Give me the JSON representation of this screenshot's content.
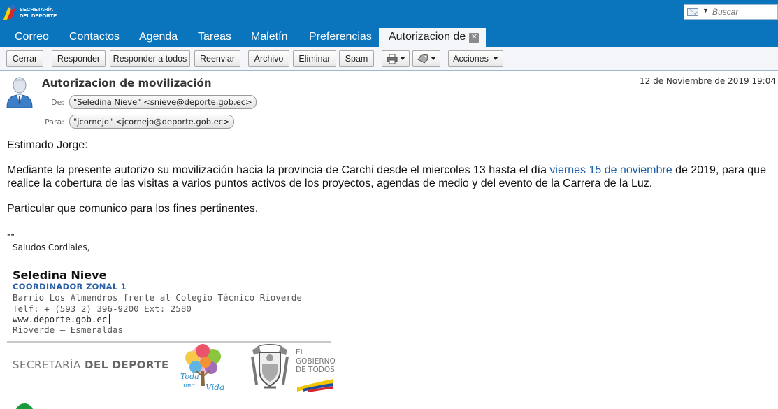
{
  "app": {
    "logo_text_line1": "SECRETARÍA",
    "logo_text_line2": "DEL DEPORTE"
  },
  "search": {
    "placeholder": "Buscar"
  },
  "tabs": [
    {
      "label": "Correo"
    },
    {
      "label": "Contactos"
    },
    {
      "label": "Agenda"
    },
    {
      "label": "Tareas"
    },
    {
      "label": "Maletín"
    },
    {
      "label": "Preferencias"
    },
    {
      "label": "Autorizacion de",
      "active": true
    }
  ],
  "toolbar": {
    "close_label": "Cerrar",
    "reply_label": "Responder",
    "reply_all_label": "Responder a todos",
    "forward_label": "Reenviar",
    "archive_label": "Archivo",
    "delete_label": "Eliminar",
    "spam_label": "Spam",
    "actions_label": "Acciones"
  },
  "message": {
    "subject": "Autorizacion de movilización",
    "date": "12 de Noviembre de 2019 19:04",
    "from_label": "De:",
    "from": "\"Seledina Nieve\" <snieve@deporte.gob.ec>",
    "to_label": "Para:",
    "to": "\"jcornejo\" <jcornejo@deporte.gob.ec>",
    "greeting": "Estimado Jorge:",
    "para1_start": "Mediante la presente autorizo su movilización hacia la provincia de Carchi desde el miercoles 13 hasta el día ",
    "para1_link": "viernes 15 de noviembre",
    "para1_end": " de 2019, para que",
    "para1_line2": "realice la cobertura de las visitas a varios puntos activos de los proyectos, agendas de medio y del evento de la Carrera de la Luz.",
    "para2": "Particular que comunico para los fines pertinentes.",
    "sig_sep": "--"
  },
  "signature": {
    "closing": "Saludos Cordiales,",
    "name": "Seledina Nieve",
    "role": "COORDINADOR ZONAL 1",
    "address": "Barrio Los Almendros frente al Colegio Técnico Rioverde",
    "phone": "Telf: + (593 2) 396-9200 Ext: 2580",
    "web": "www.deporte.gob.ec",
    "city": "Rioverde – Esmeraldas",
    "brand_light": "SECRETARÍA ",
    "brand_bold": "DEL DEPORTE",
    "toda_line1": "Toda",
    "toda_line2": "una",
    "toda_line3": "Vida",
    "gob_line1": "EL",
    "gob_line2": "GOBIERNO",
    "gob_line3": "DE TODOS"
  },
  "colors": {
    "header_blue": "#0a74bd",
    "link_blue": "#1a5fa8",
    "role_blue": "#2a5fa5"
  }
}
